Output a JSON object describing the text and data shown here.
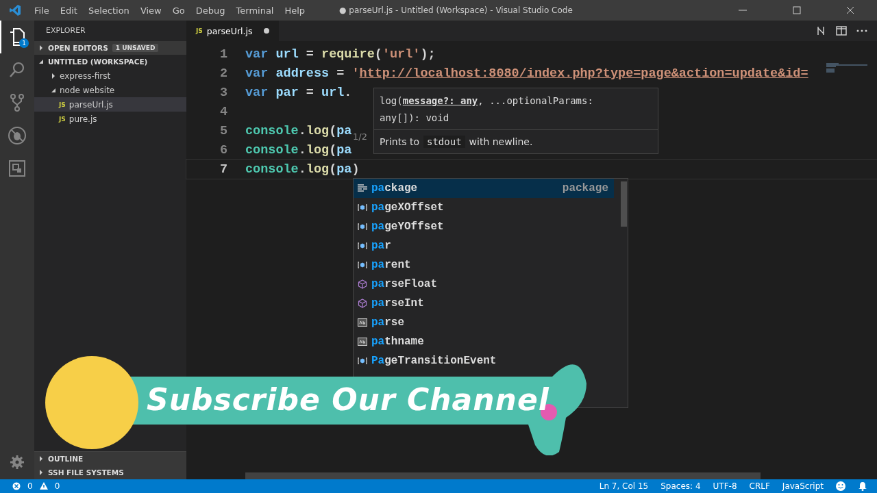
{
  "window": {
    "title": "● parseUrl.js - Untitled (Workspace) - Visual Studio Code"
  },
  "menu": [
    "File",
    "Edit",
    "Selection",
    "View",
    "Go",
    "Debug",
    "Terminal",
    "Help"
  ],
  "activity_bar": [
    {
      "kind": "files",
      "selected": true,
      "badge": "1"
    },
    {
      "kind": "search",
      "selected": false
    },
    {
      "kind": "source-control",
      "selected": false
    },
    {
      "kind": "debug",
      "selected": false
    },
    {
      "kind": "extensions",
      "selected": false
    }
  ],
  "sidebar": {
    "title": "EXPLORER",
    "sections": [
      {
        "label": "OPEN EDITORS",
        "expanded": false,
        "badge": "1 UNSAVED"
      },
      {
        "label": "UNTITLED (WORKSPACE)",
        "expanded": true,
        "children": [
          {
            "label": "express-first",
            "kind": "folder",
            "expanded": false,
            "selected": false
          },
          {
            "label": "node website",
            "kind": "folder",
            "expanded": true,
            "selected": false,
            "children": [
              {
                "label": "parseUrl.js",
                "kind": "file",
                "icon_label": "JS",
                "selected": true
              },
              {
                "label": "pure.js",
                "kind": "file",
                "icon_label": "JS",
                "selected": false
              }
            ]
          }
        ]
      }
    ],
    "bottom_sections": [
      {
        "label": "OUTLINE",
        "expanded": false
      },
      {
        "label": "SSH FILE SYSTEMS",
        "expanded": false
      }
    ]
  },
  "tabs": [
    {
      "label": "parseUrl.js",
      "icon_label": "JS",
      "selected": true,
      "dirty": true
    }
  ],
  "editor": {
    "lines": [
      {
        "number": "1",
        "current": false,
        "tokens": [
          {
            "kind": "keyword",
            "text": "var "
          },
          {
            "kind": "variable",
            "text": "url"
          },
          {
            "kind": "punct",
            "text": " = "
          },
          {
            "kind": "function",
            "text": "require"
          },
          {
            "kind": "punct",
            "text": "("
          },
          {
            "kind": "string",
            "text": "'url'"
          },
          {
            "kind": "punct",
            "text": ");"
          }
        ]
      },
      {
        "number": "2",
        "current": false,
        "tokens": [
          {
            "kind": "keyword",
            "text": "var "
          },
          {
            "kind": "variable",
            "text": "address"
          },
          {
            "kind": "punct",
            "text": " = "
          },
          {
            "kind": "string",
            "text": "'"
          },
          {
            "kind": "link",
            "text": "http://localhost:8080/index.php?type=page&action=update&id="
          }
        ]
      },
      {
        "number": "3",
        "current": false,
        "tokens": [
          {
            "kind": "keyword",
            "text": "var "
          },
          {
            "kind": "variable",
            "text": "par"
          },
          {
            "kind": "punct",
            "text": " = "
          },
          {
            "kind": "variable",
            "text": "url"
          },
          {
            "kind": "punct",
            "text": "."
          }
        ]
      },
      {
        "number": "4",
        "current": false
      },
      {
        "number": "5",
        "current": false,
        "tokens": [
          {
            "kind": "class",
            "text": "console"
          },
          {
            "kind": "punct",
            "text": "."
          },
          {
            "kind": "function",
            "text": "log"
          },
          {
            "kind": "punct",
            "text": "("
          },
          {
            "kind": "variable",
            "text": "pa"
          }
        ]
      },
      {
        "number": "6",
        "current": false,
        "tokens": [
          {
            "kind": "class",
            "text": "console"
          },
          {
            "kind": "punct",
            "text": "."
          },
          {
            "kind": "function",
            "text": "log"
          },
          {
            "kind": "punct",
            "text": "("
          },
          {
            "kind": "variable",
            "text": "pa"
          }
        ]
      },
      {
        "number": "7",
        "current": true,
        "tokens": [
          {
            "kind": "class",
            "text": "console"
          },
          {
            "kind": "punct",
            "text": "."
          },
          {
            "kind": "function",
            "text": "log"
          },
          {
            "kind": "punct",
            "text": "("
          },
          {
            "kind": "variable",
            "text": "pa"
          },
          {
            "kind": "punct",
            "text": ")"
          }
        ]
      }
    ],
    "hover": {
      "overload": "1/2",
      "signature": "log(**message?: any**, ...optionalParams:",
      "signature_cont": "any[]): void",
      "doc_before": "Prints to",
      "doc_code": "stdout",
      "doc_after": "with newline."
    },
    "suggestions": [
      {
        "match": "pa",
        "rest": "ckage",
        "kind": "keyword",
        "selected": true,
        "detail": "package"
      },
      {
        "match": "pa",
        "rest": "geXOffset",
        "kind": "variable",
        "selected": false
      },
      {
        "match": "pa",
        "rest": "geYOffset",
        "kind": "variable",
        "selected": false
      },
      {
        "match": "pa",
        "rest": "r",
        "kind": "variable",
        "selected": false
      },
      {
        "match": "pa",
        "rest": "rent",
        "kind": "variable",
        "selected": false
      },
      {
        "match": "pa",
        "rest": "rseFloat",
        "kind": "method",
        "selected": false
      },
      {
        "match": "pa",
        "rest": "rseInt",
        "kind": "method",
        "selected": false
      },
      {
        "match": "pa",
        "rest": "rse",
        "kind": "text",
        "selected": false
      },
      {
        "match": "pa",
        "rest": "thname",
        "kind": "text",
        "selected": false
      },
      {
        "match": "Pa",
        "rest": "geTransitionEvent",
        "kind": "variable",
        "selected": false
      }
    ]
  },
  "overlay_banner": {
    "text": "Subscribe Our Channel"
  },
  "status_bar": {
    "errors": "0",
    "warnings": "0",
    "items": [
      "Ln 7, Col 15",
      "Spaces: 4",
      "UTF-8",
      "CRLF",
      "JavaScript"
    ]
  }
}
